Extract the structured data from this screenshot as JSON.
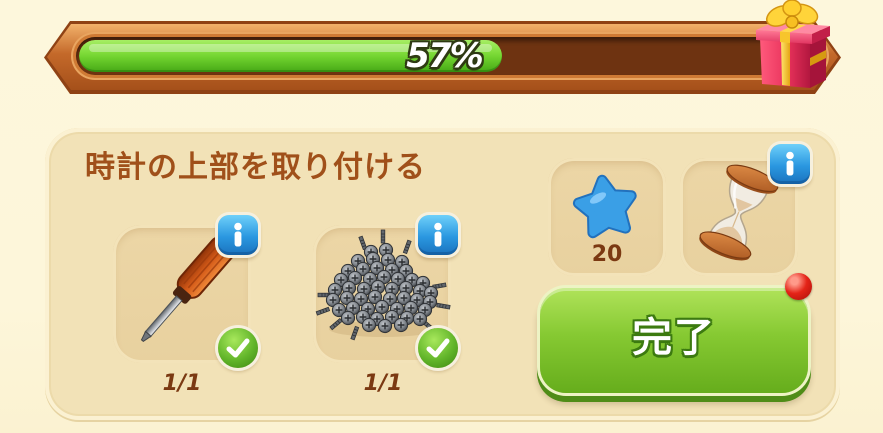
{
  "progress": {
    "percent_label": "57%",
    "value": 0.57,
    "reward_icon": "gift-box-icon"
  },
  "task": {
    "title": "時計の上部を取り付ける",
    "items": [
      {
        "icon": "screwdriver-icon",
        "count": "1/1",
        "complete": true,
        "info_icon": "info-icon",
        "status_icon": "checkmark-icon"
      },
      {
        "icon": "screws-icon",
        "count": "1/1",
        "complete": true,
        "info_icon": "info-icon",
        "status_icon": "checkmark-icon"
      }
    ],
    "cost": {
      "icon": "blue-star-icon",
      "amount": "20"
    },
    "duration": {
      "icon": "hourglass-icon",
      "info_icon": "info-icon"
    },
    "complete_button": {
      "label": "完了",
      "has_notification": true,
      "notification_icon": "red-dot-icon"
    }
  },
  "colors": {
    "background": "#fdf6da",
    "panel": "#f2e2b7",
    "slot": "#e8d19f",
    "title_text": "#a0501a",
    "count_text": "#7b3912",
    "progress_fill": "#6fd12e",
    "progress_track": "#6e3311",
    "progress_frame": "#c4692a",
    "button_green": "#86c932",
    "info_blue": "#2a97e0",
    "check_green": "#62b52a",
    "notification_red": "#e42418",
    "star_blue": "#3a9fe6"
  }
}
